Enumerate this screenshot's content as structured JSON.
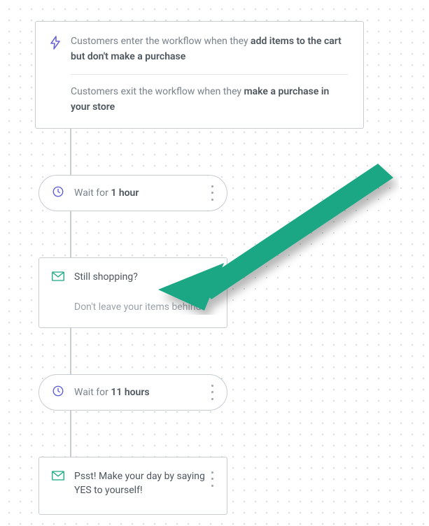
{
  "trigger": {
    "enter_prefix": "Customers enter the workflow when they ",
    "enter_bold": "add items to the cart but don't make a purchase",
    "exit_prefix": "Customers exit the workflow when they ",
    "exit_bold": "make a purchase in your store"
  },
  "steps": [
    {
      "type": "wait",
      "prefix": "Wait for ",
      "duration": "1 hour"
    },
    {
      "type": "email",
      "title": "Still shopping?",
      "subtitle": "Don't leave your items behind!"
    },
    {
      "type": "wait",
      "prefix": "Wait for ",
      "duration": "11 hours"
    },
    {
      "type": "email",
      "title": "Psst! Make your day by saying YES to yourself!",
      "subtitle": ""
    }
  ],
  "colors": {
    "accent_teal": "#1ba784",
    "accent_purple": "#5b5bd6"
  }
}
